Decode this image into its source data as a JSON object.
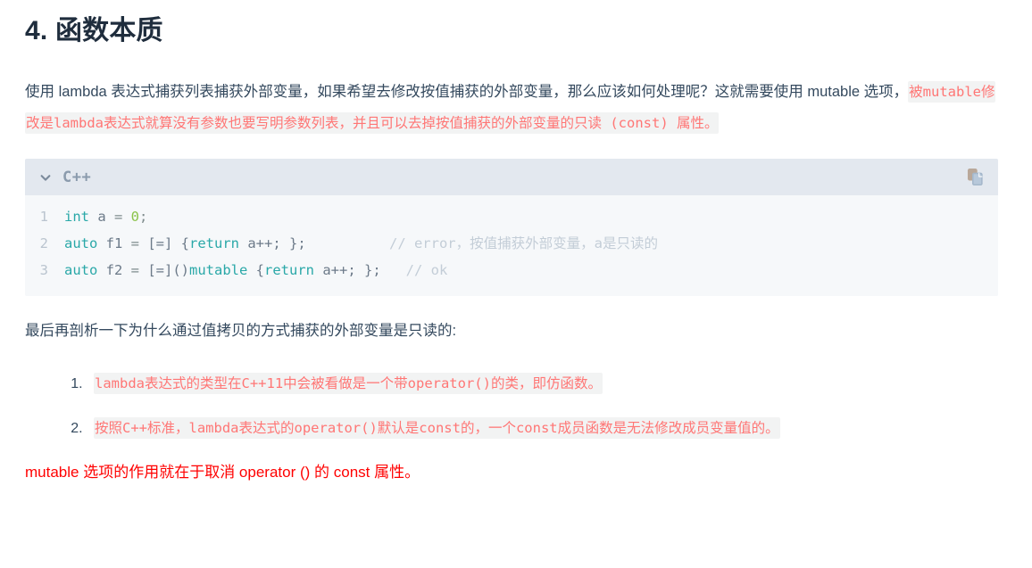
{
  "heading": "4. 函数本质",
  "intro": {
    "lead": "使用 lambda 表达式捕获列表捕获外部变量，如果希望去修改按值捕获的外部变量，那么应该如何处理呢？这就需要使用 mutable 选项，",
    "highlight": "被mutable修改是lambda表达式就算没有参数也要写明参数列表，并且可以去掉按值捕获的外部变量的只读 (const) 属性。"
  },
  "code_block": {
    "language": "C++",
    "collapse_icon": "chevron-down-icon",
    "copy_icon": "copy-icon",
    "lines": [
      {
        "number": "1",
        "tokens": [
          {
            "t": "int",
            "c": "tok-kw"
          },
          {
            "t": " a ",
            "c": "tok-plain"
          },
          {
            "t": "= ",
            "c": "tok-punct"
          },
          {
            "t": "0",
            "c": "tok-num"
          },
          {
            "t": ";",
            "c": "tok-punct"
          }
        ]
      },
      {
        "number": "2",
        "tokens": [
          {
            "t": "auto",
            "c": "tok-kw"
          },
          {
            "t": " f1 ",
            "c": "tok-plain"
          },
          {
            "t": "= ",
            "c": "tok-punct"
          },
          {
            "t": "[=] {",
            "c": "tok-plain"
          },
          {
            "t": "return",
            "c": "tok-kw"
          },
          {
            "t": " a++; };",
            "c": "tok-plain"
          },
          {
            "t": "          ",
            "c": "tok-plain"
          },
          {
            "t": "// error，按值捕获外部变量，a是只读的",
            "c": "tok-comment"
          }
        ]
      },
      {
        "number": "3",
        "tokens": [
          {
            "t": "auto",
            "c": "tok-kw"
          },
          {
            "t": " f2 ",
            "c": "tok-plain"
          },
          {
            "t": "= ",
            "c": "tok-punct"
          },
          {
            "t": "[=]()",
            "c": "tok-plain"
          },
          {
            "t": "mutable",
            "c": "tok-kw"
          },
          {
            "t": " {",
            "c": "tok-plain"
          },
          {
            "t": "return",
            "c": "tok-kw"
          },
          {
            "t": " a++; };",
            "c": "tok-plain"
          },
          {
            "t": "   ",
            "c": "tok-plain"
          },
          {
            "t": "// ok",
            "c": "tok-comment"
          }
        ]
      }
    ]
  },
  "analysis_paragraph": "最后再剖析一下为什么通过值拷贝的方式捕获的外部变量是只读的:",
  "reasons": [
    "lambda表达式的类型在C++11中会被看做是一个带operator()的类，即仿函数。",
    "按照C++标准，lambda表达式的operator()默认是const的，一个const成员函数是无法修改成员变量值的。"
  ],
  "conclusion": "mutable 选项的作用就在于取消 operator () 的 const 属性。"
}
